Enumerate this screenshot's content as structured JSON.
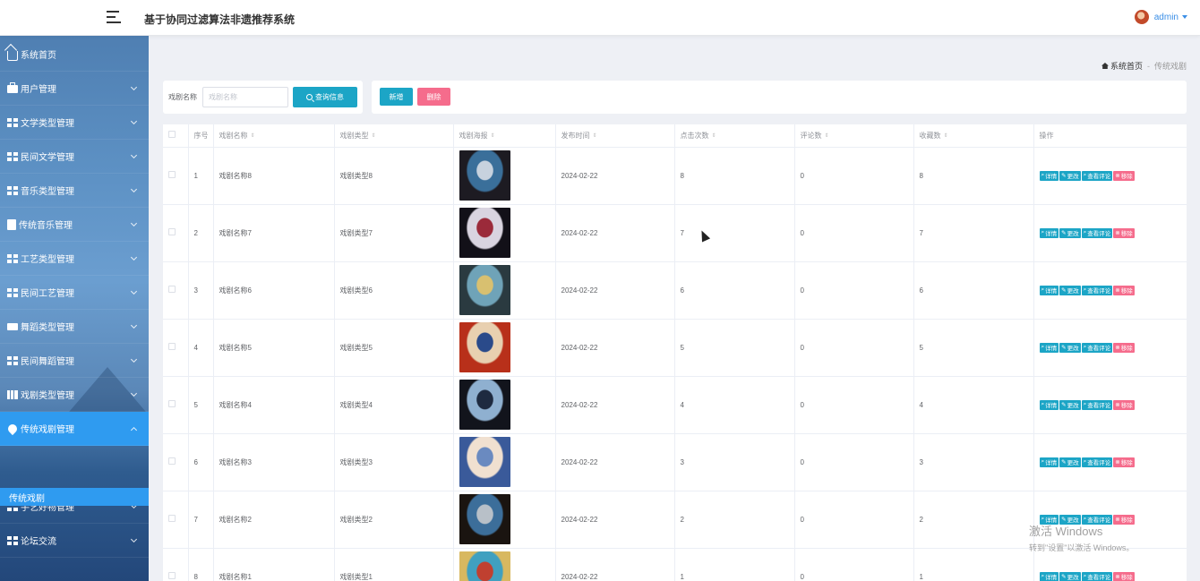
{
  "header": {
    "title": "基于协同过滤算法非遗推荐系统",
    "user": "admin"
  },
  "sidebar": {
    "home": "系统首页",
    "menus": [
      {
        "label": "用户管理",
        "icon": "briefcase-icon"
      },
      {
        "label": "文学类型管理",
        "icon": "grid-icon"
      },
      {
        "label": "民间文学管理",
        "icon": "grid-icon"
      },
      {
        "label": "音乐类型管理",
        "icon": "grid-icon"
      },
      {
        "label": "传统音乐管理",
        "icon": "document-icon"
      },
      {
        "label": "工艺类型管理",
        "icon": "grid-icon"
      },
      {
        "label": "民间工艺管理",
        "icon": "grid-icon"
      },
      {
        "label": "舞蹈类型管理",
        "icon": "card-icon"
      },
      {
        "label": "民间舞蹈管理",
        "icon": "grid-icon"
      },
      {
        "label": "戏剧类型管理",
        "icon": "book-icon"
      },
      {
        "label": "传统戏剧管理",
        "icon": "location-pin-icon"
      },
      {
        "label": "手艺好物管理",
        "icon": "grid-icon"
      },
      {
        "label": "论坛交流",
        "icon": "grid-icon"
      }
    ],
    "active_sub": "传统戏剧"
  },
  "breadcrumb": {
    "home": "系统首页",
    "separator": "-",
    "current": "传统戏剧"
  },
  "search": {
    "label": "戏剧名称",
    "placeholder": "戏剧名称",
    "button": "查询信息"
  },
  "actions": {
    "add": "新增",
    "delete": "删除"
  },
  "table": {
    "columns": [
      "序号",
      "戏剧名称",
      "戏剧类型",
      "戏剧海报",
      "发布时间",
      "点击次数",
      "评论数",
      "收藏数",
      "操作"
    ],
    "operations": [
      "详情",
      "更改",
      "查看评论",
      "移除"
    ],
    "rows": [
      {
        "no": "1",
        "name": "戏剧名称8",
        "type": "戏剧类型8",
        "date": "2024-02-22",
        "clicks": "8",
        "comments": "0",
        "favorites": "8"
      },
      {
        "no": "2",
        "name": "戏剧名称7",
        "type": "戏剧类型7",
        "date": "2024-02-22",
        "clicks": "7",
        "comments": "0",
        "favorites": "7"
      },
      {
        "no": "3",
        "name": "戏剧名称6",
        "type": "戏剧类型6",
        "date": "2024-02-22",
        "clicks": "6",
        "comments": "0",
        "favorites": "6"
      },
      {
        "no": "4",
        "name": "戏剧名称5",
        "type": "戏剧类型5",
        "date": "2024-02-22",
        "clicks": "5",
        "comments": "0",
        "favorites": "5"
      },
      {
        "no": "5",
        "name": "戏剧名称4",
        "type": "戏剧类型4",
        "date": "2024-02-22",
        "clicks": "4",
        "comments": "0",
        "favorites": "4"
      },
      {
        "no": "6",
        "name": "戏剧名称3",
        "type": "戏剧类型3",
        "date": "2024-02-22",
        "clicks": "3",
        "comments": "0",
        "favorites": "3"
      },
      {
        "no": "7",
        "name": "戏剧名称2",
        "type": "戏剧类型2",
        "date": "2024-02-22",
        "clicks": "2",
        "comments": "0",
        "favorites": "2"
      },
      {
        "no": "8",
        "name": "戏剧名称1",
        "type": "戏剧类型1",
        "date": "2024-02-22",
        "clicks": "1",
        "comments": "0",
        "favorites": "1"
      }
    ]
  },
  "watermark": {
    "title": "激活 Windows",
    "subtitle": "转到\"设置\"以激活 Windows。"
  },
  "colors": {
    "accent": "#1ca5c6",
    "danger": "#f56c8c",
    "sidebar_active": "#2f9bf0"
  }
}
